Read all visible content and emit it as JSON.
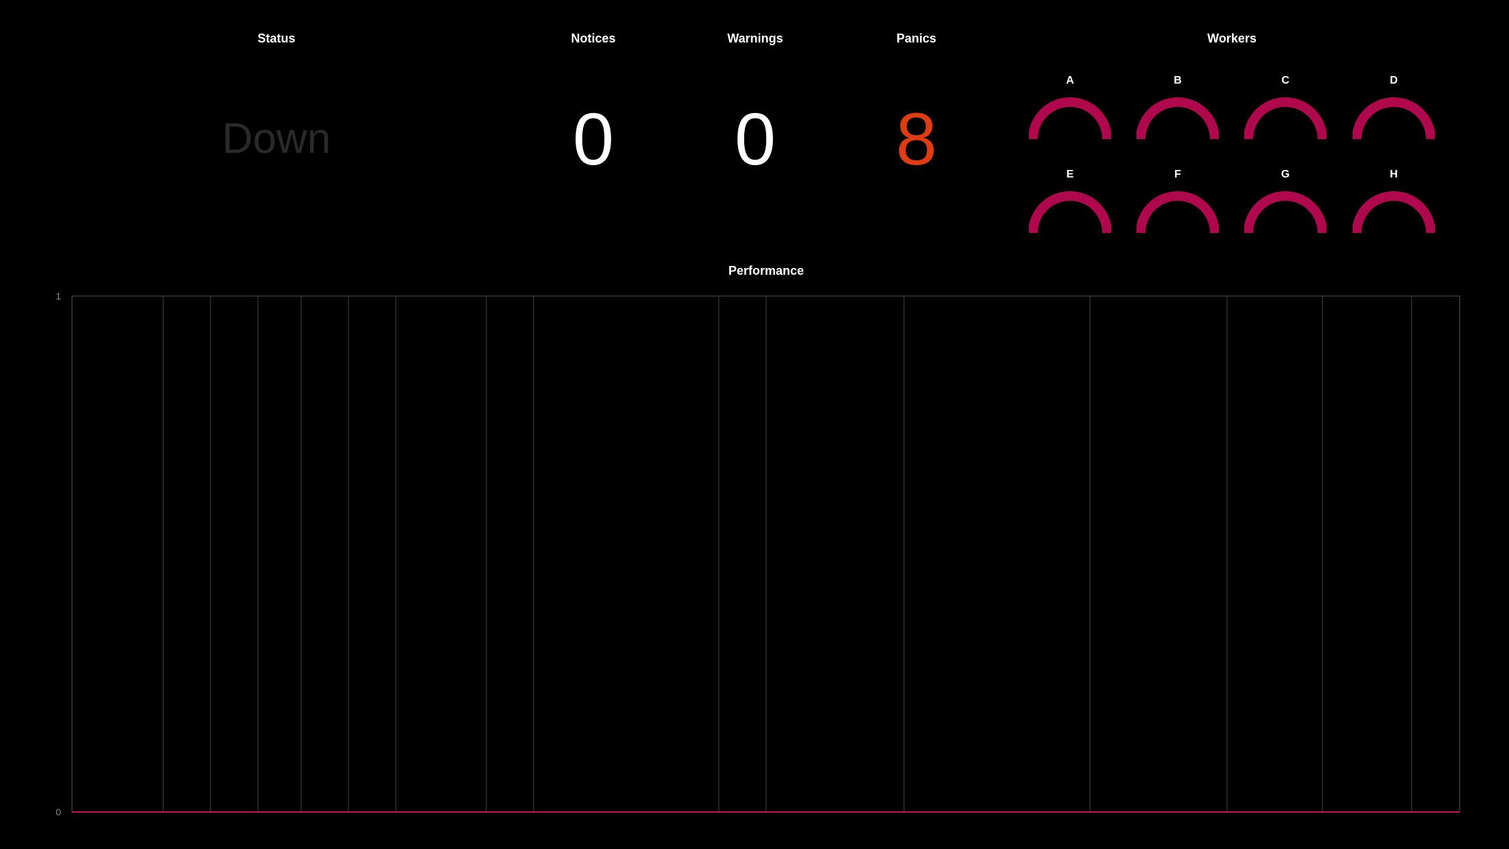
{
  "panels": {
    "status": {
      "title": "Status",
      "value": "Down"
    },
    "notices": {
      "title": "Notices",
      "value": "0"
    },
    "warnings": {
      "title": "Warnings",
      "value": "0"
    },
    "panics": {
      "title": "Panics",
      "value": "8",
      "color": "#e03c14"
    }
  },
  "workers": {
    "title": "Workers",
    "gauge_color": "#b0084c",
    "items": [
      {
        "label": "A"
      },
      {
        "label": "B"
      },
      {
        "label": "C"
      },
      {
        "label": "D"
      },
      {
        "label": "E"
      },
      {
        "label": "F"
      },
      {
        "label": "G"
      },
      {
        "label": "H"
      }
    ]
  },
  "performance": {
    "title": "Performance"
  },
  "chart_data": {
    "type": "line",
    "title": "Performance",
    "xlabel": "",
    "ylabel": "",
    "ylim": [
      0,
      1
    ],
    "y_ticks": [
      "0",
      "1"
    ],
    "grid": "vertical",
    "line_color": "#c8104c",
    "series": [
      {
        "values": [
          0,
          0,
          0,
          0,
          0,
          0,
          0,
          0,
          0,
          0,
          0,
          0,
          0,
          0,
          0,
          0,
          0
        ]
      }
    ]
  }
}
